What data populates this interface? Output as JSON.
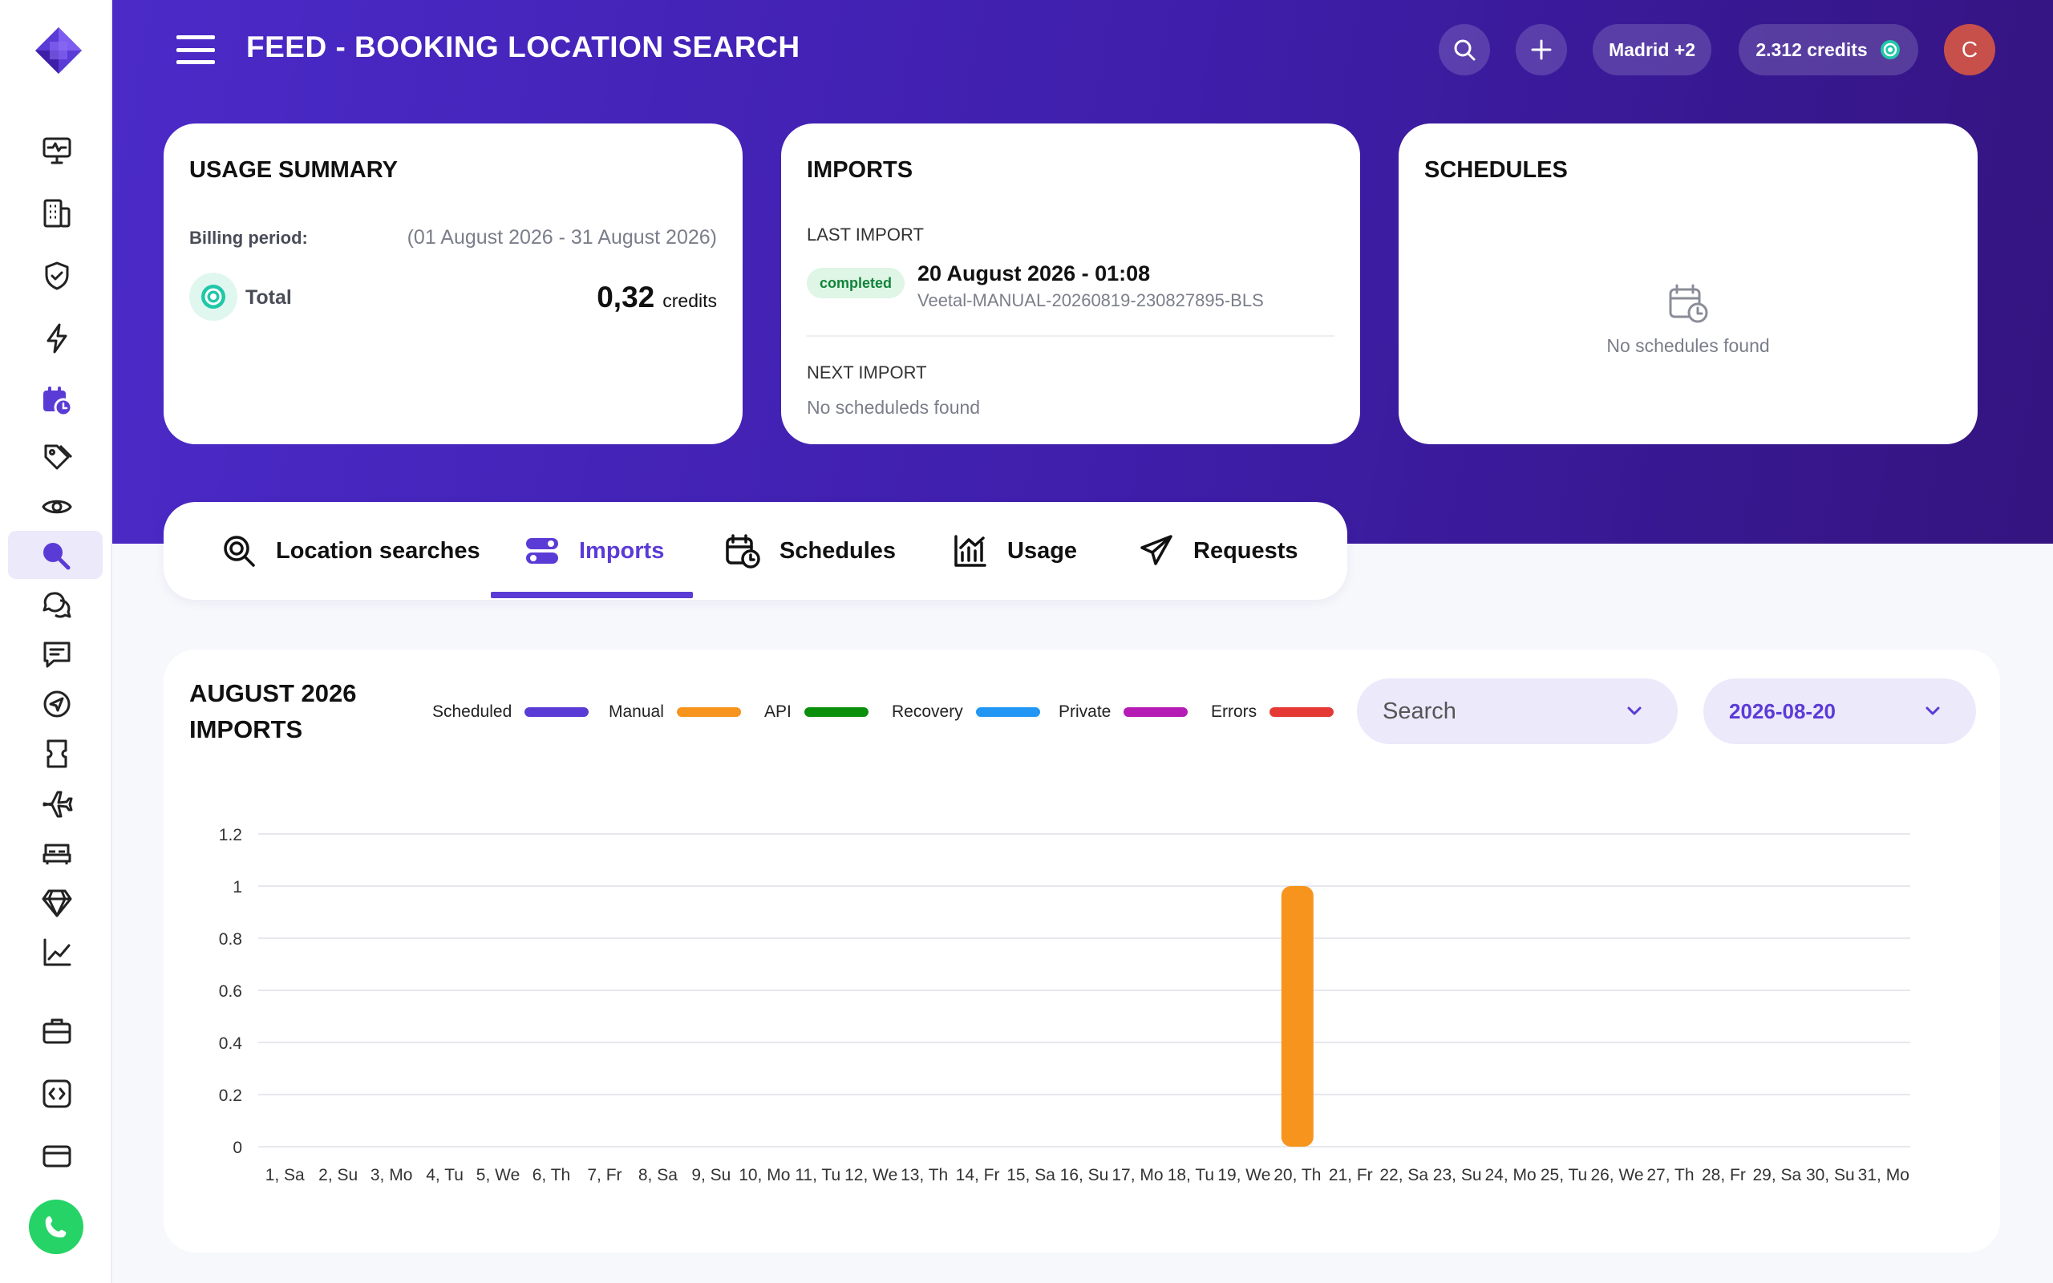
{
  "header": {
    "title": "FEED - BOOKING LOCATION SEARCH",
    "location_pill": "Madrid +2",
    "credits_pill": "2.312 credits",
    "avatar_initial": "C"
  },
  "cards": {
    "usage": {
      "title": "USAGE SUMMARY",
      "billing_label": "Billing period:",
      "billing_period": "(01 August 2026 - 31 August 2026)",
      "total_label": "Total",
      "total_value": "0,32",
      "total_unit": "credits"
    },
    "imports": {
      "title": "IMPORTS",
      "last_label": "LAST IMPORT",
      "status": "completed",
      "last_date": "20 August 2026 - 01:08",
      "last_id": "Veetal-MANUAL-20260819-230827895-BLS",
      "next_label": "NEXT IMPORT",
      "next_value": "No scheduleds found"
    },
    "schedules": {
      "title": "SCHEDULES",
      "empty": "No schedules found"
    }
  },
  "tabs": [
    {
      "label": "Location searches",
      "icon": "search-scan-icon"
    },
    {
      "label": "Imports",
      "icon": "toggle-list-icon"
    },
    {
      "label": "Schedules",
      "icon": "calendar-clock-icon"
    },
    {
      "label": "Usage",
      "icon": "chart-bar-icon"
    },
    {
      "label": "Requests",
      "icon": "paper-plane-icon"
    }
  ],
  "chart_panel": {
    "title_line1": "AUGUST 2026",
    "title_line2": "IMPORTS",
    "search_select": "Search",
    "date_select": "2026-08-20"
  },
  "colors": {
    "accent": "#5b3bd6",
    "scheduled": "#5b3bd6",
    "manual": "#f7941d",
    "api": "#0a8f0a",
    "recovery": "#2196f3",
    "private": "#b51bb5",
    "errors": "#e53935"
  },
  "chart_data": {
    "type": "bar",
    "title": "AUGUST 2026 IMPORTS",
    "categories": [
      "1, Sa",
      "2, Su",
      "3, Mo",
      "4, Tu",
      "5, We",
      "6, Th",
      "7, Fr",
      "8, Sa",
      "9, Su",
      "10, Mo",
      "11, Tu",
      "12, We",
      "13, Th",
      "14, Fr",
      "15, Sa",
      "16, Su",
      "17, Mo",
      "18, Tu",
      "19, We",
      "20, Th",
      "21, Fr",
      "22, Sa",
      "23, Su",
      "24, Mo",
      "25, Tu",
      "26, We",
      "27, Th",
      "28, Fr",
      "29, Sa",
      "30, Su",
      "31, Mo"
    ],
    "series": [
      {
        "name": "Scheduled",
        "color": "#5b3bd6",
        "values": [
          0,
          0,
          0,
          0,
          0,
          0,
          0,
          0,
          0,
          0,
          0,
          0,
          0,
          0,
          0,
          0,
          0,
          0,
          0,
          0,
          0,
          0,
          0,
          0,
          0,
          0,
          0,
          0,
          0,
          0,
          0
        ]
      },
      {
        "name": "Manual",
        "color": "#f7941d",
        "values": [
          0,
          0,
          0,
          0,
          0,
          0,
          0,
          0,
          0,
          0,
          0,
          0,
          0,
          0,
          0,
          0,
          0,
          0,
          0,
          1,
          0,
          0,
          0,
          0,
          0,
          0,
          0,
          0,
          0,
          0,
          0
        ]
      },
      {
        "name": "API",
        "color": "#0a8f0a",
        "values": [
          0,
          0,
          0,
          0,
          0,
          0,
          0,
          0,
          0,
          0,
          0,
          0,
          0,
          0,
          0,
          0,
          0,
          0,
          0,
          0,
          0,
          0,
          0,
          0,
          0,
          0,
          0,
          0,
          0,
          0,
          0
        ]
      },
      {
        "name": "Recovery",
        "color": "#2196f3",
        "values": [
          0,
          0,
          0,
          0,
          0,
          0,
          0,
          0,
          0,
          0,
          0,
          0,
          0,
          0,
          0,
          0,
          0,
          0,
          0,
          0,
          0,
          0,
          0,
          0,
          0,
          0,
          0,
          0,
          0,
          0,
          0
        ]
      },
      {
        "name": "Private",
        "color": "#b51bb5",
        "values": [
          0,
          0,
          0,
          0,
          0,
          0,
          0,
          0,
          0,
          0,
          0,
          0,
          0,
          0,
          0,
          0,
          0,
          0,
          0,
          0,
          0,
          0,
          0,
          0,
          0,
          0,
          0,
          0,
          0,
          0,
          0
        ]
      },
      {
        "name": "Errors",
        "color": "#e53935",
        "values": [
          0,
          0,
          0,
          0,
          0,
          0,
          0,
          0,
          0,
          0,
          0,
          0,
          0,
          0,
          0,
          0,
          0,
          0,
          0,
          0,
          0,
          0,
          0,
          0,
          0,
          0,
          0,
          0,
          0,
          0,
          0
        ]
      }
    ],
    "ylim": [
      0,
      1.2
    ],
    "yticks": [
      "0",
      "0.2",
      "0.4",
      "0.6",
      "0.8",
      "1",
      "1.2"
    ],
    "grid": true,
    "legend": "top"
  }
}
